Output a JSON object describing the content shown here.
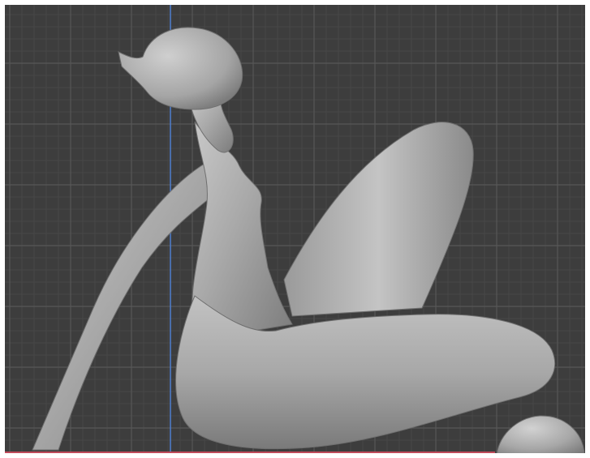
{
  "viewport": {
    "name": "3D Viewport",
    "background_color": "#3d3d3d",
    "minor_grid_color": "#4a4a4a",
    "major_grid_color": "#575757",
    "axis_z_color": "#4f7fd0",
    "axis_x_color": "#c04a5a",
    "frame_color": "#ffffff"
  },
  "scene": {
    "main_object": "sculpted-figure-mesh",
    "secondary_object": "sphere-mesh",
    "mesh_color": "#a6a6a6"
  }
}
